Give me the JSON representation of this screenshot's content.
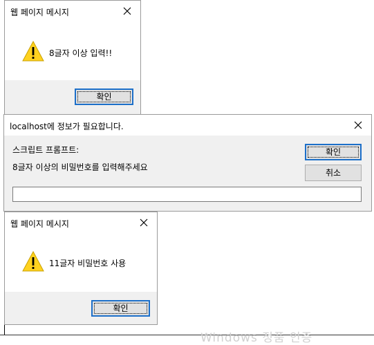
{
  "dialog1": {
    "title": "웹 페이지 메시지",
    "message": "8글자 이상 입력!!",
    "ok_label": "확인",
    "icon": "warning-icon"
  },
  "prompt": {
    "title": "localhost에 정보가 필요합니다.",
    "heading": "스크립트 프롬프트:",
    "message": "8글자 이상의 비밀번호를 입력해주세요",
    "input_value": "",
    "ok_label": "확인",
    "cancel_label": "취소"
  },
  "dialog2": {
    "title": "웹 페이지 메시지",
    "message": "11글자 비밀번호 사용",
    "ok_label": "확인",
    "icon": "warning-icon"
  },
  "watermark": "Windows 정품 인증",
  "colors": {
    "dialog_bg": "#ffffff",
    "footer_bg": "#f0f0f0",
    "warning_fill": "#ffd21f",
    "default_button_border": "#1c6fc9"
  }
}
